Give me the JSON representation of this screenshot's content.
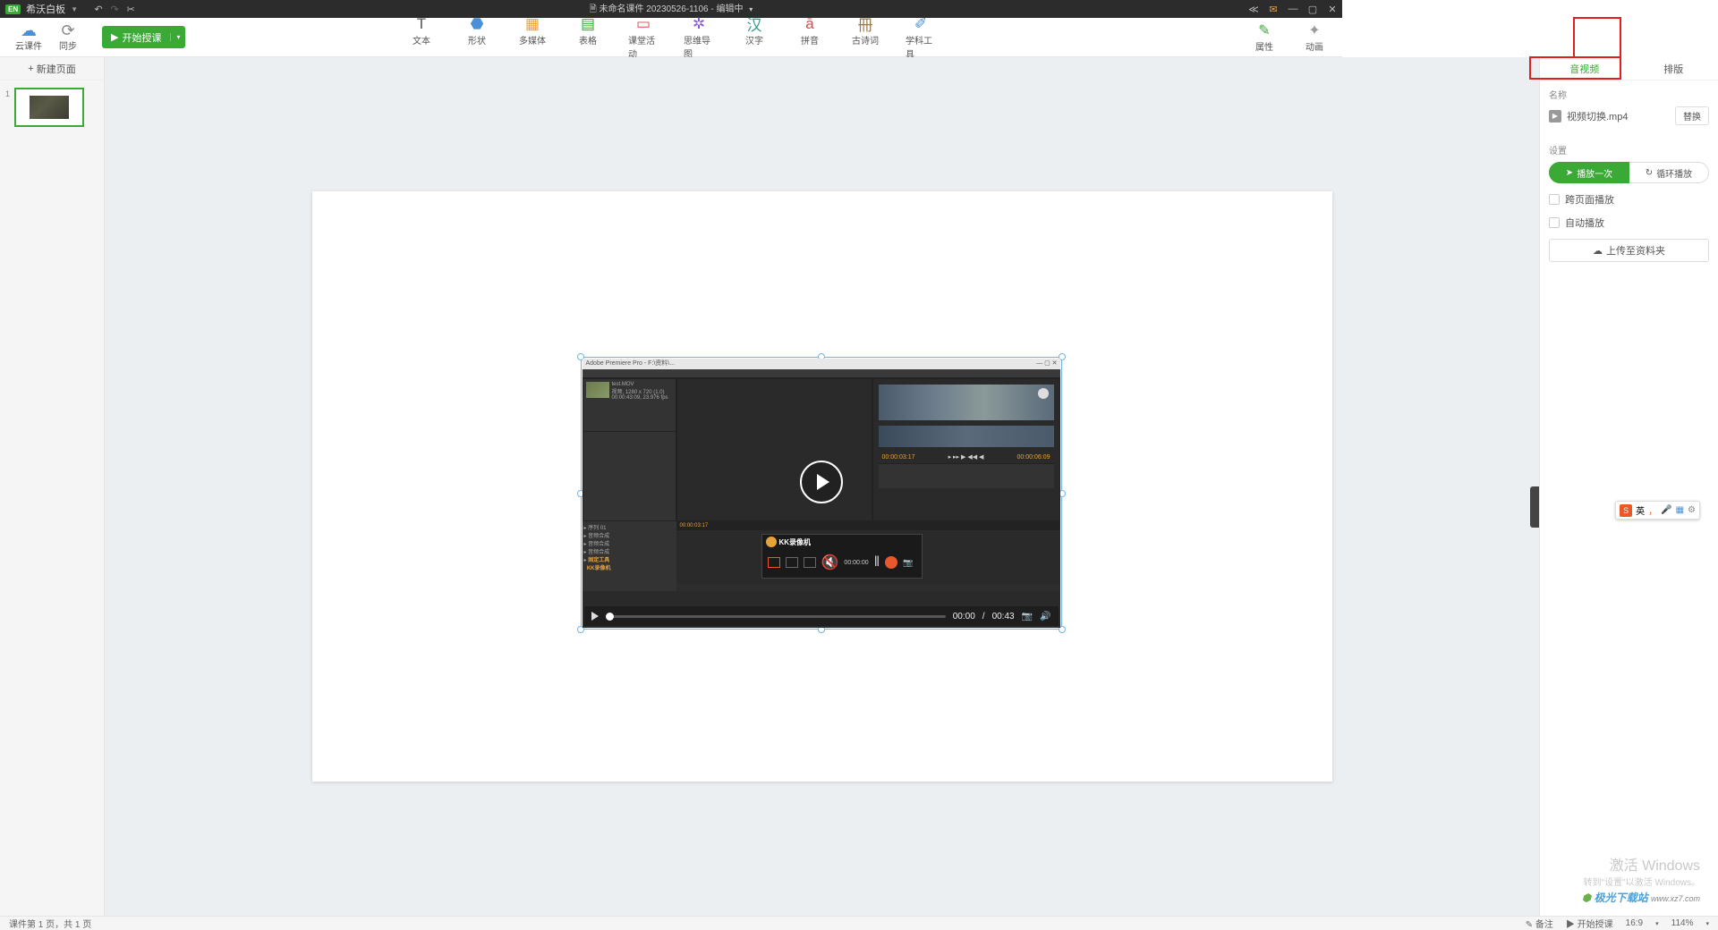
{
  "titlebar": {
    "logo": "EN",
    "app_name": "希沃白板",
    "doc_icon": "🗎",
    "doc_title": "未命名课件 20230526-1106 - 编辑中"
  },
  "toolbar_left": {
    "cloud": "云课件",
    "sync": "同步",
    "start": "开始授课"
  },
  "tools": [
    {
      "icon": "T",
      "label": "文本",
      "cls": ""
    },
    {
      "icon": "⬣",
      "label": "形状",
      "cls": "c-blue"
    },
    {
      "icon": "▦",
      "label": "多媒体",
      "cls": "c-orange"
    },
    {
      "icon": "▤",
      "label": "表格",
      "cls": "c-green"
    },
    {
      "icon": "▭",
      "label": "课堂活动",
      "cls": "c-red"
    },
    {
      "icon": "✲",
      "label": "思维导图",
      "cls": "c-purple"
    },
    {
      "icon": "汉",
      "label": "汉字",
      "cls": "c-teal"
    },
    {
      "icon": "ā",
      "label": "拼音",
      "cls": "c-red"
    },
    {
      "icon": "冊",
      "label": "古诗词",
      "cls": "c-brown"
    },
    {
      "icon": "✐",
      "label": "学科工具",
      "cls": "c-blue"
    }
  ],
  "toolbar_right": {
    "attr": "属性",
    "anim": "动画"
  },
  "left": {
    "newpage": "新建页面",
    "pagenum": "1"
  },
  "video": {
    "app_title": "Adobe Premiere Pro - F:\\资料\\...",
    "kk": "KK录像机",
    "kk_time": "00:00:00",
    "tc1": "00:00:03:17",
    "tc2": "00:00:06:09",
    "tl_tc": "00:00:03:17",
    "cur": "00:00",
    "dur": "00:43"
  },
  "right": {
    "tab1": "音视频",
    "tab2": "排版",
    "name_label": "名称",
    "filename": "视频切换.mp4",
    "replace": "替换",
    "settings_label": "设置",
    "play_once": "播放一次",
    "loop": "循环播放",
    "cross_page": "跨页面播放",
    "autoplay": "自动播放",
    "upload": "上传至资料夹"
  },
  "status": {
    "left": "课件第 1 页，共 1 页",
    "note": "备注",
    "start": "开始授课",
    "ratio": "16:9",
    "zoom": "114%"
  },
  "watermark": {
    "l1": "激活 Windows",
    "l2": "转到\"设置\"以激活 Windows。",
    "l3a": "极光下载站",
    "l3b": "www.xz7.com"
  },
  "ime": {
    "s": "S",
    "lang": "英",
    "p": "，",
    "mic": "🎤",
    "grid": "▦",
    "opt": "⚙"
  }
}
